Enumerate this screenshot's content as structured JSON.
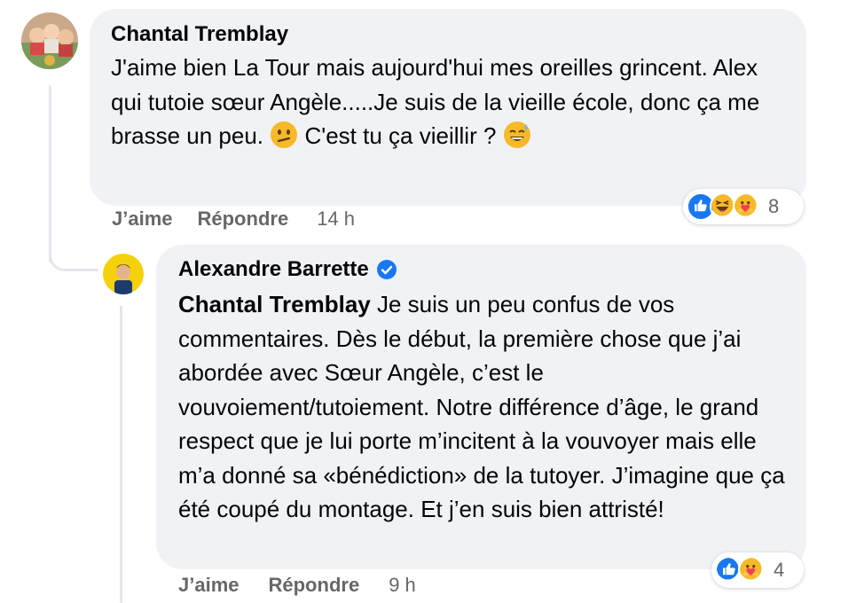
{
  "comment": {
    "author": "Chantal Tremblay",
    "text": "J'aime bien La Tour mais aujourd'hui mes oreilles grincent. Alex qui tutoie sœur Angèle.....Je suis de la vieille école, donc ça me brasse un peu.",
    "text_after_emoji": "C'est tu ça vieillir ?",
    "emoji_1": "confused-face",
    "emoji_2": "grinning-sweat-face",
    "like_label": "J’aime",
    "reply_label": "Répondre",
    "time": "14 h",
    "reaction_count": "8",
    "reaction_types": [
      "like",
      "haha",
      "care"
    ]
  },
  "reply": {
    "author": "Alexandre Barrette",
    "verified": true,
    "mention": "Chantal Tremblay",
    "text": "Je suis un peu confus de vos commentaires. Dès le début, la première chose que j’ai abordée avec Sœur Angèle, c’est le vouvoiement/tutoiement. Notre différence d’âge, le grand respect que je lui porte m’incitent à la vouvoyer mais elle m’a donné sa «bénédiction» de la tutoyer. J’imagine que ça été coupé du montage. Et j’en suis bien attristé!",
    "like_label": "J’aime",
    "reply_label": "Répondre",
    "time": "9 h",
    "reaction_count": "4",
    "reaction_types": [
      "like",
      "care"
    ]
  },
  "colors": {
    "bubble": "#f0f2f5",
    "meta": "#65676b",
    "like_blue": "#1877f2",
    "haha_yellow": "#f7b928",
    "verified_blue": "#1877f2"
  }
}
